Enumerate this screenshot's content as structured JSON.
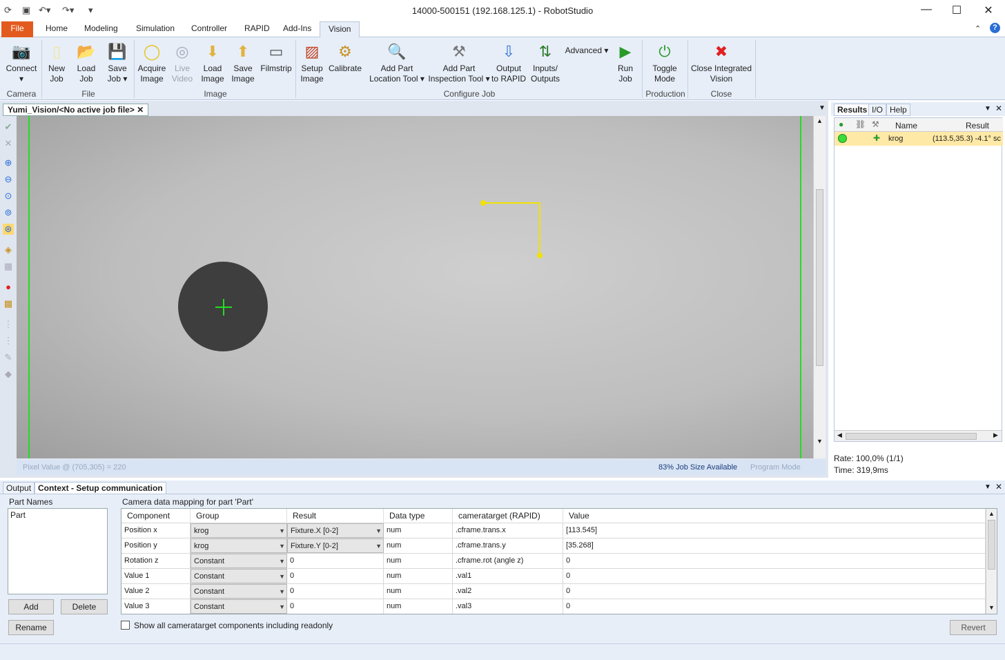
{
  "window": {
    "title": "14000-500151 (192.168.125.1) - RobotStudio"
  },
  "tabs": [
    "File",
    "Home",
    "Modeling",
    "Simulation",
    "Controller",
    "RAPID",
    "Add-Ins",
    "Vision"
  ],
  "active_tab": "Vision",
  "ribbon": {
    "camera": {
      "label": "Camera",
      "connect": "Connect"
    },
    "file": {
      "label": "File",
      "new_job_1": "New",
      "new_job_2": "Job",
      "load_job_1": "Load",
      "load_job_2": "Job",
      "save_job_1": "Save",
      "save_job_2": "Job"
    },
    "image": {
      "label": "Image",
      "acquire_1": "Acquire",
      "acquire_2": "Image",
      "live_1": "Live",
      "live_2": "Video",
      "load_1": "Load",
      "load_2": "Image",
      "save_1": "Save",
      "save_2": "Image",
      "filmstrip": "Filmstrip"
    },
    "configure": {
      "label": "Configure Job",
      "setup_1": "Setup",
      "setup_2": "Image",
      "calibrate": "Calibrate",
      "addloc_1": "Add Part",
      "addloc_2": "Location Tool",
      "addinsp_1": "Add Part",
      "addinsp_2": "Inspection Tool",
      "output_1": "Output",
      "output_2": "to RAPID",
      "io_1": "Inputs/",
      "io_2": "Outputs",
      "advanced": "Advanced",
      "run_1": "Run",
      "run_2": "Job"
    },
    "production": {
      "label": "Production",
      "toggle_1": "Toggle",
      "toggle_2": "Mode"
    },
    "close": {
      "label": "Close",
      "close_1": "Close Integrated",
      "close_2": "Vision"
    }
  },
  "doc_tab": "Yumi_Vision/<No active job file>",
  "status": {
    "pixel": "Pixel Value @ (705,305) = 220",
    "jobsize": "83% Job Size Available",
    "mode": "Program Mode"
  },
  "results": {
    "tabs": [
      "Results",
      "I/O",
      "Help"
    ],
    "headers": {
      "name": "Name",
      "result": "Result"
    },
    "row": {
      "name": "krog",
      "result": "(113.5,35.3) -4.1° sc"
    },
    "rate": "Rate: 100,0% (1/1)",
    "time": "Time: 319,9ms"
  },
  "bottom": {
    "tabs": [
      "Output",
      "Context - Setup communication"
    ],
    "part_names_label": "Part Names",
    "parts": [
      "Part"
    ],
    "mapping_label": "Camera data mapping for part 'Part'",
    "add": "Add",
    "delete": "Delete",
    "rename": "Rename",
    "show_all": "Show all cameratarget components including readonly",
    "revert": "Revert",
    "columns": [
      "Component",
      "Group",
      "Result",
      "Data type",
      "cameratarget (RAPID)",
      "Value"
    ],
    "rows": [
      {
        "component": "Position x",
        "group": "krog",
        "result": "Fixture.X [0-2]",
        "datatype": "num",
        "target": ".cframe.trans.x",
        "value": "[113.545]"
      },
      {
        "component": "Position y",
        "group": "krog",
        "result": "Fixture.Y [0-2]",
        "datatype": "num",
        "target": ".cframe.trans.y",
        "value": "[35.268]"
      },
      {
        "component": "Rotation z",
        "group": "Constant",
        "result": "0",
        "datatype": "num",
        "target": ".cframe.rot (angle z)",
        "value": "0"
      },
      {
        "component": "Value 1",
        "group": "Constant",
        "result": "0",
        "datatype": "num",
        "target": ".val1",
        "value": "0"
      },
      {
        "component": "Value 2",
        "group": "Constant",
        "result": "0",
        "datatype": "num",
        "target": ".val2",
        "value": "0"
      },
      {
        "component": "Value 3",
        "group": "Constant",
        "result": "0",
        "datatype": "num",
        "target": ".val3",
        "value": "0"
      }
    ]
  }
}
